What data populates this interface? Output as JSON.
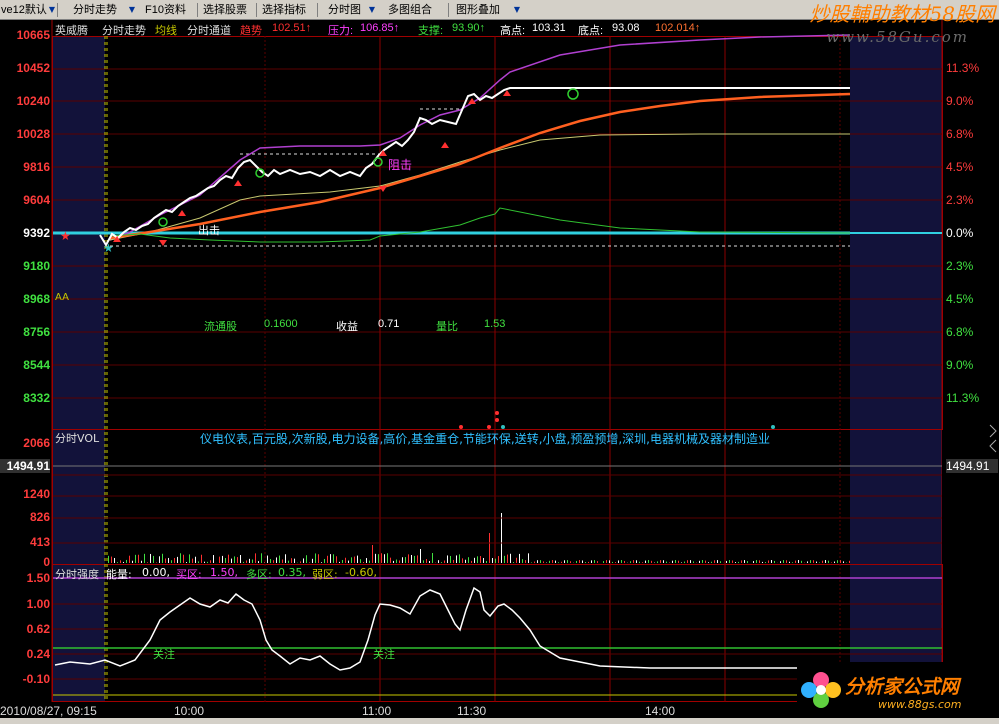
{
  "toolbar": {
    "items": [
      "ve12默认",
      "分时走势",
      "F10资料",
      "选择股票",
      "选择指标",
      "分时图",
      "多图组合",
      "图形叠加"
    ]
  },
  "watermark": {
    "title": "炒股輔助教材58股网",
    "url": "www.58Gu.com",
    "bottom_brand": "分析家公式网",
    "bottom_url": "www.88gs.com"
  },
  "main_legend": {
    "stock_name": "英威腾",
    "chart_name": "分时走势",
    "avg": "均线",
    "channel": "分时通道",
    "trend_label": "趋势",
    "trend_value": "102.51↑",
    "pressure_label": "压力:",
    "pressure_value": "106.85↑",
    "support_label": "支撑:",
    "support_value": "93.90↑",
    "high_label": "高点:",
    "high_value": "103.31",
    "low_label": "底点:",
    "low_value": "93.08",
    "last_value": "102.014↑"
  },
  "price_axis_left": [
    "10665",
    "10452",
    "10240",
    "10028",
    "9816",
    "9604",
    "9392",
    "9180",
    "8968",
    "8756",
    "8544",
    "8332"
  ],
  "pct_axis_right": [
    "11.3%",
    "9.0%",
    "6.8%",
    "4.5%",
    "2.3%",
    "0.0%",
    "2.3%",
    "4.5%",
    "6.8%",
    "9.0%",
    "11.3%"
  ],
  "annotations": {
    "block": "阻击",
    "out": "出击",
    "aa": "AA",
    "focus1": "关注",
    "focus2": "关注"
  },
  "stats": {
    "float_label": "流通股",
    "float_value": "0.1600",
    "eps_label": "收益",
    "eps_value": "0.71",
    "vr_label": "量比",
    "vr_value": "1.53"
  },
  "vol_panel": {
    "title": "分时VOL",
    "concepts": "仪电仪表,百元股,次新股,电力设备,高价,基金重仓,节能环保,送转,小盘,预盈预增,深圳,电器机械及器材制造业",
    "left_axis": [
      "2066",
      "1494.91",
      "1240",
      "826",
      "413",
      "0"
    ],
    "right_value": "1494.91"
  },
  "strength_panel": {
    "title": "分时强度",
    "energy_label": "能量:",
    "energy_value": "0.00,",
    "buy_label": "买区:",
    "buy_value": "1.50,",
    "multi_label": "多区:",
    "multi_value": "0.35,",
    "weak_label": "弱区:",
    "weak_value": "-0.60,",
    "left_axis": [
      "1.50",
      "1.00",
      "0.62",
      "0.24",
      "-0.10"
    ]
  },
  "time_axis": {
    "date": "2010/08/27, 09:15",
    "ticks": [
      "10:00",
      "11:00",
      "11:30",
      "14:00"
    ]
  },
  "chart_data": [
    {
      "type": "line",
      "title": "分时走势",
      "x": [
        "09:30",
        "09:40",
        "09:50",
        "10:00",
        "10:10",
        "10:20",
        "10:30",
        "10:40",
        "10:50",
        "11:00",
        "11:10",
        "11:20",
        "11:30",
        "13:10",
        "13:30",
        "14:00",
        "14:30",
        "15:00"
      ],
      "series": [
        {
          "name": "price",
          "values": [
            93.92,
            94.1,
            95.1,
            96.4,
            97.8,
            97.0,
            97.2,
            97.3,
            97.2,
            99.2,
            100.2,
            101.0,
            102.1,
            102.5,
            102.5,
            102.5,
            102.5,
            102.5
          ]
        },
        {
          "name": "均线",
          "values": [
            93.92,
            94.2,
            94.6,
            95.2,
            95.8,
            96.3,
            96.7,
            97.1,
            97.5,
            98.0,
            98.6,
            99.2,
            99.9,
            100.4,
            100.9,
            101.5,
            101.9,
            102.0
          ]
        }
      ],
      "ylim": [
        83.32,
        106.65
      ]
    },
    {
      "type": "line",
      "title": "分时强度",
      "x": [
        "09:30",
        "09:50",
        "10:00",
        "10:20",
        "10:30",
        "10:50",
        "11:00",
        "11:10",
        "11:20",
        "11:30",
        "11:40",
        "13:10",
        "13:30",
        "14:00",
        "15:00"
      ],
      "series": [
        {
          "name": "能量",
          "values": [
            0.1,
            0.2,
            0.9,
            1.05,
            1.05,
            0.2,
            0.1,
            1.0,
            1.3,
            1.0,
            1.35,
            1.0,
            0.4,
            0.05,
            0.0
          ]
        }
      ],
      "ylim": [
        -0.3,
        1.6
      ]
    }
  ]
}
